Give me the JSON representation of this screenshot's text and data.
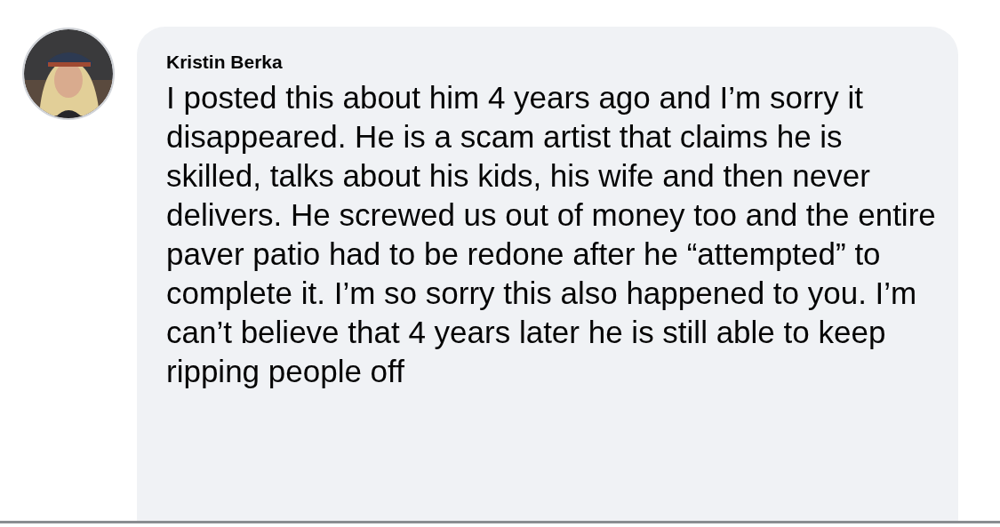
{
  "comment": {
    "author": "Kristin Berka",
    "text": "I posted this about him 4 years ago and I’m sorry it disappeared. He is a scam artist that claims he is skilled, talks about his kids, his wife and then never delivers. He screwed us out of money too and the entire paver patio had to be redone after he “attempted” to complete it. I’m so sorry this also happened to you. I’m can’t believe that 4 years later he is still able to keep ripping people off"
  }
}
